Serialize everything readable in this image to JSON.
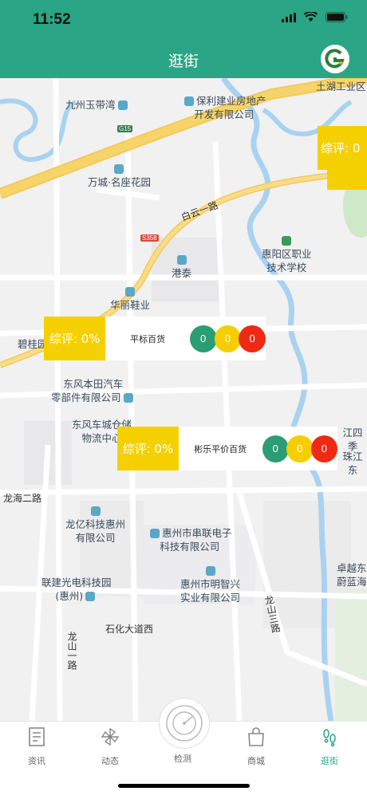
{
  "status": {
    "time": "11:52"
  },
  "nav": {
    "title": "逛街"
  },
  "map": {
    "pois": [
      "九州玉带湾",
      "保利建业房地产\n开发有限公司",
      "万城·名座花园",
      "港泰",
      "惠阳区职业\n技术学校",
      "华丽鞋业",
      "碧桂园",
      "东风本田汽车\n零部件有限公司",
      "东风车城仓储\n物流中心",
      "龙亿科技惠州\n有限公司",
      "惠州市串联电子\n科技有限公司",
      "联建光电科技园\n(惠州)",
      "惠州市明智兴\n实业有限公司",
      "土湖工业区",
      "卓越东\n蔚蓝海",
      "江四季",
      "珠江东"
    ],
    "roads": [
      "白云一路",
      "龙海二路",
      "石化大道西",
      "龙山一路",
      "龙山三路"
    ],
    "shields": [
      "G15",
      "S358"
    ]
  },
  "markers": [
    {
      "score": "综评: 0%",
      "name": "平标百货",
      "green": "0",
      "yellow": "0",
      "red": "0"
    },
    {
      "score": "综评: 0%",
      "name": "彬乐平价百货",
      "green": "0",
      "yellow": "0",
      "red": "0"
    },
    {
      "score": "综评: 0"
    }
  ],
  "tabs": [
    {
      "label": "资讯",
      "icon": "news-icon"
    },
    {
      "label": "动态",
      "icon": "pinwheel-icon"
    },
    {
      "label": "检测",
      "icon": "radar-icon"
    },
    {
      "label": "商城",
      "icon": "shopping-bag-icon"
    },
    {
      "label": "逛街",
      "icon": "footprints-icon"
    }
  ],
  "colors": {
    "primary": "#2aa585",
    "score_yellow": "#f5d000",
    "green_dot": "#2a9d75",
    "red_dot": "#ee2a14"
  }
}
